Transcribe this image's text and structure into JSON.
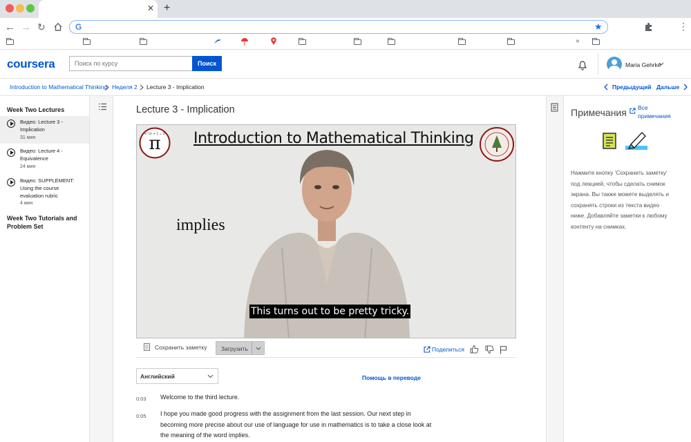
{
  "browser": {
    "tabs": [
      {
        "label": ""
      }
    ],
    "new_tab": "+",
    "address": "",
    "bookmarks_more": "»"
  },
  "header": {
    "logo": "coursera",
    "search_placeholder": "Поиск по курсу",
    "search_button": "Поиск",
    "user_name": "Maria Gehrke"
  },
  "breadcrumb": {
    "items": [
      "Introduction to Mathematical Thinking",
      "Неделя 2",
      "Lecture 3 - Implication"
    ],
    "prev": "Предыдущий",
    "next": "Дальше"
  },
  "sidebar": {
    "section1": "Week Two Lectures",
    "items": [
      {
        "line1": "Видео: Lecture 3 -",
        "line2": "Implication",
        "line3": "",
        "duration": "31 мин"
      },
      {
        "line1": "Видео: Lecture 4 -",
        "line2": "Equivalence",
        "line3": "",
        "duration": "24 мин"
      },
      {
        "line1": "Видео: SUPPLEMENT:",
        "line2": "Using the course",
        "line3": "evaluation rubric",
        "duration": "4 мин"
      }
    ],
    "section2_line1": "Week Two Tutorials and",
    "section2_line2": "Problem Set"
  },
  "main": {
    "title": "Lecture 3 - Implication",
    "video": {
      "slide_title": "Introduction to Mathematical Thinking",
      "slide_word": "implies",
      "caption": "This turns out to be pretty tricky."
    },
    "save_note": "Сохранить заметку",
    "download": "Загрузить",
    "share": "Поделиться",
    "language": "Английский",
    "help_translate": "Помощь в переводе",
    "transcript": [
      {
        "time": "0:03",
        "lines": [
          "Welcome to the third lecture."
        ]
      },
      {
        "time": "0:05",
        "lines": [
          "I hope you made good progress with the assignment from the last session. Our next step in",
          "becoming more precise about our use of language for use in mathematics is to take a close look at",
          "the meaning of the word implies."
        ]
      }
    ]
  },
  "notes": {
    "title": "Примечания",
    "all_notes_line1": "Все",
    "all_notes_line2": "примечания",
    "body": [
      "Нажмите кнопку 'Сохранить заметку'",
      "под лекцией, чтобы сделать снимок",
      "экрана. Вы также можете выделять и",
      "сохранять строки из текста видео",
      "ниже. Добавляйте заметки к любому",
      "контенту на снимках."
    ]
  },
  "colors": {
    "brand": "#0056d2",
    "link": "#0056d2"
  }
}
